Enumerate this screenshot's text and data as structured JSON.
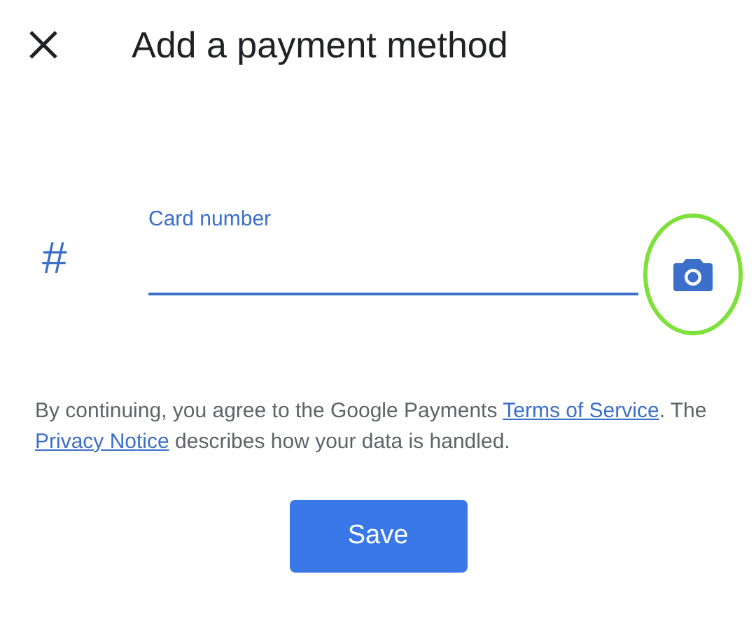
{
  "header": {
    "title": "Add a payment method"
  },
  "field": {
    "icon": "#",
    "label": "Card number",
    "focused": true
  },
  "notice": {
    "parts": [
      {
        "kind": "text",
        "text": "By continuing, you agree to the Google Payments "
      },
      {
        "kind": "link",
        "text": "Terms of Service"
      },
      {
        "kind": "text",
        "text": ". The "
      },
      {
        "kind": "link",
        "text": "Privacy Notice"
      },
      {
        "kind": "text",
        "text": " describes how your data is handled."
      }
    ]
  },
  "save_button": "Save"
}
